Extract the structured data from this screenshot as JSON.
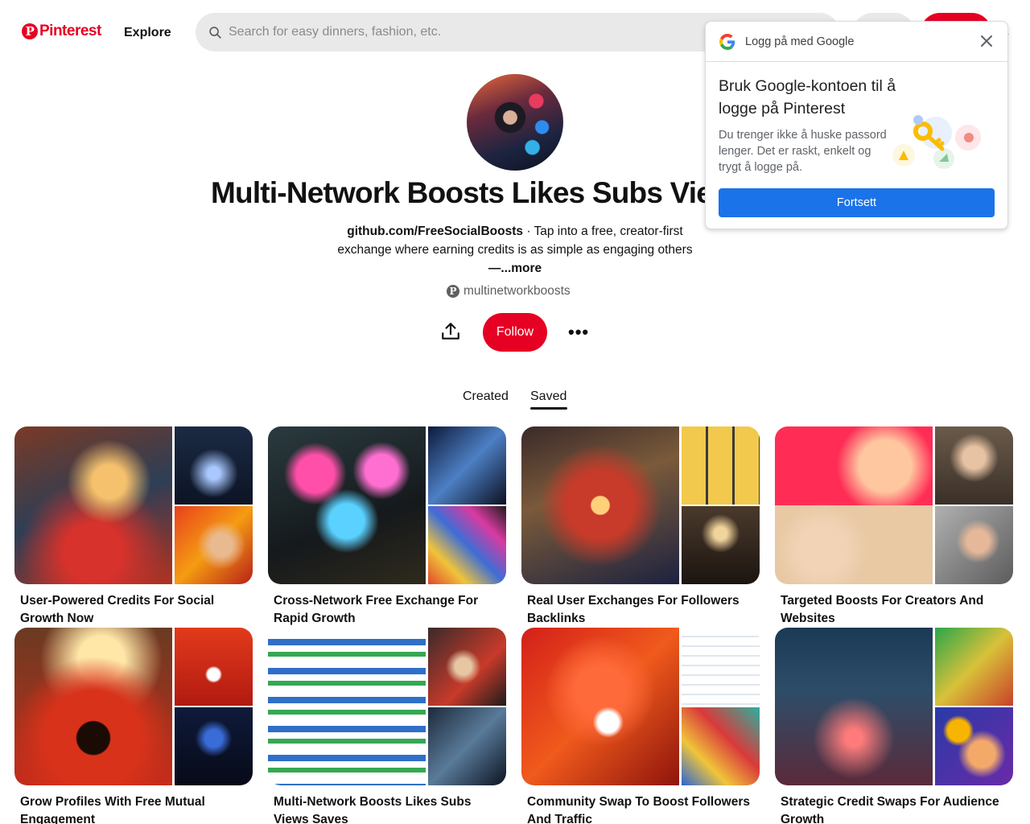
{
  "header": {
    "logo_text": "Pinterest",
    "logo_glyph": "P",
    "explore_label": "Explore",
    "search_placeholder": "Search for easy dinners, fashion, etc."
  },
  "profile": {
    "name": "Multi-Network Boosts Likes Subs Views Saves",
    "bio_link": "github.com/FreeSocialBoosts",
    "bio_text": " · Tap into a free, creator-first exchange where earning credits is as simple as engaging others",
    "bio_more": "—...more",
    "handle": "multinetworkboosts",
    "follow_label": "Follow",
    "more_glyph": "•••"
  },
  "tabs": {
    "created": "Created",
    "saved": "Saved",
    "active": "saved"
  },
  "boards": [
    {
      "title": "User-Powered Credits For Social Growth Now"
    },
    {
      "title": "Cross-Network Free Exchange For Rapid Growth"
    },
    {
      "title": "Real User Exchanges For Followers Backlinks"
    },
    {
      "title": "Targeted Boosts For Creators And Websites"
    },
    {
      "title": "Grow Profiles With Free Mutual Engagement"
    },
    {
      "title": "Multi-Network Boosts Likes Subs Views Saves"
    },
    {
      "title": "Community Swap To Boost Followers And Traffic"
    },
    {
      "title": "Strategic Credit Swaps For Audience Growth"
    }
  ],
  "google_popup": {
    "header_text": "Logg på med Google",
    "title": "Bruk Google-kontoen til å logge på Pinterest",
    "description": "Du trenger ikke å huske passord lenger. Det er raskt, enkelt og trygt å logge på.",
    "continue_label": "Fortsett"
  },
  "colors": {
    "brand_red": "#e60023",
    "google_blue": "#1a73e8"
  }
}
